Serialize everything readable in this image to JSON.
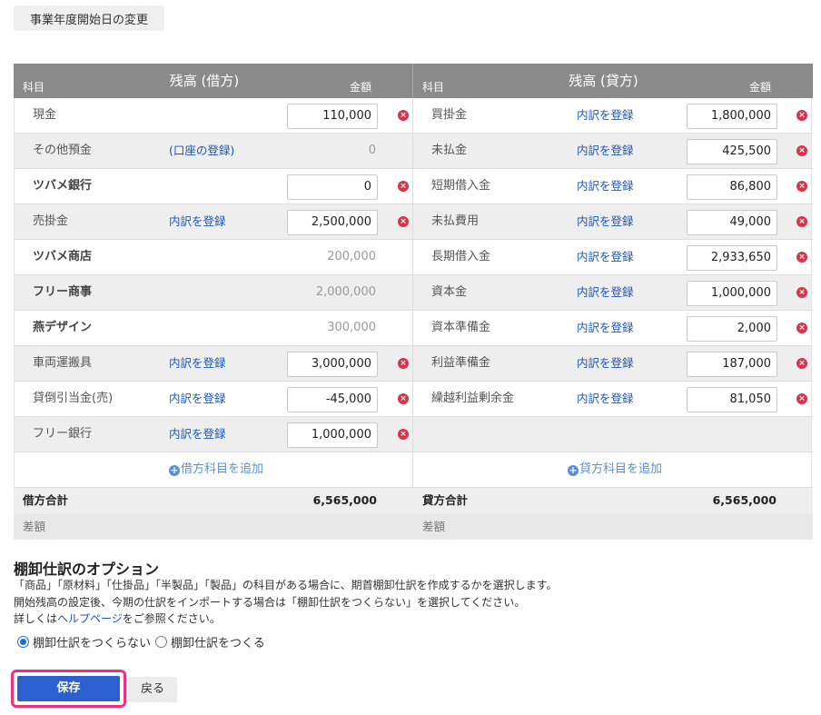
{
  "top_button": "事業年度開始日の変更",
  "header": {
    "left": {
      "subject": "科目",
      "title": "残高 (借方)",
      "amount": "金額"
    },
    "right": {
      "subject": "科目",
      "title": "残高 (貸方)",
      "amount": "金額"
    }
  },
  "debit": [
    {
      "name": "現金",
      "bold": false,
      "link": "",
      "value": "110,000",
      "editable": true
    },
    {
      "name": "その他預金",
      "bold": false,
      "link": "(口座の登録)",
      "value": "0",
      "editable": false
    },
    {
      "name": "ツバメ銀行",
      "bold": true,
      "link": "",
      "value": "0",
      "editable": true
    },
    {
      "name": "売掛金",
      "bold": false,
      "link": "内訳を登録",
      "value": "2,500,000",
      "editable": true
    },
    {
      "name": "ツバメ商店",
      "bold": true,
      "link": "",
      "value": "200,000",
      "editable": false
    },
    {
      "name": "フリー商事",
      "bold": true,
      "link": "",
      "value": "2,000,000",
      "editable": false
    },
    {
      "name": "燕デザイン",
      "bold": true,
      "link": "",
      "value": "300,000",
      "editable": false
    },
    {
      "name": "車両運搬具",
      "bold": false,
      "link": "内訳を登録",
      "value": "3,000,000",
      "editable": true
    },
    {
      "name": "貸倒引当金(売)",
      "bold": false,
      "link": "内訳を登録",
      "value": "-45,000",
      "editable": true
    },
    {
      "name": "フリー銀行",
      "bold": false,
      "link": "内訳を登録",
      "value": "1,000,000",
      "editable": true
    }
  ],
  "credit": [
    {
      "name": "買掛金",
      "link": "内訳を登録",
      "value": "1,800,000"
    },
    {
      "name": "未払金",
      "link": "内訳を登録",
      "value": "425,500"
    },
    {
      "name": "短期借入金",
      "link": "内訳を登録",
      "value": "86,800"
    },
    {
      "name": "未払費用",
      "link": "内訳を登録",
      "value": "49,000"
    },
    {
      "name": "長期借入金",
      "link": "内訳を登録",
      "value": "2,933,650"
    },
    {
      "name": "資本金",
      "link": "内訳を登録",
      "value": "1,000,000"
    },
    {
      "name": "資本準備金",
      "link": "内訳を登録",
      "value": "2,000"
    },
    {
      "name": "利益準備金",
      "link": "内訳を登録",
      "value": "187,000"
    },
    {
      "name": "繰越利益剰余金",
      "link": "内訳を登録",
      "value": "81,050"
    }
  ],
  "add": {
    "debit": "借方科目を追加",
    "credit": "貸方科目を追加"
  },
  "totals": {
    "debit_label": "借方合計",
    "debit_value": "6,565,000",
    "credit_label": "貸方合計",
    "credit_value": "6,565,000",
    "diff_label": "差額"
  },
  "options": {
    "title": "棚卸仕訳のオプション",
    "line1": "「商品」「原材料」「仕掛品」「半製品」「製品」の科目がある場合に、期首棚卸仕訳を作成するかを選択します。",
    "line2": "開始残高の設定後、今期の仕訳をインポートする場合は「棚卸仕訳をつくらない」を選択してください。",
    "line3_pre": "詳しくは",
    "line3_link": "ヘルプページ",
    "line3_post": "をご参照ください。",
    "radio1": "棚卸仕訳をつくらない",
    "radio2": "棚卸仕訳をつくる",
    "selected": "radio1"
  },
  "buttons": {
    "save": "保存",
    "back": "戻る"
  },
  "colors": {
    "header": "#8a8a8a",
    "delete": "#d9334a",
    "primary": "#2c5fcf",
    "highlight": "#e8357a",
    "link": "#1a56b8"
  },
  "icons": {
    "delete": "circle-x-icon",
    "add": "circle-plus-icon"
  }
}
